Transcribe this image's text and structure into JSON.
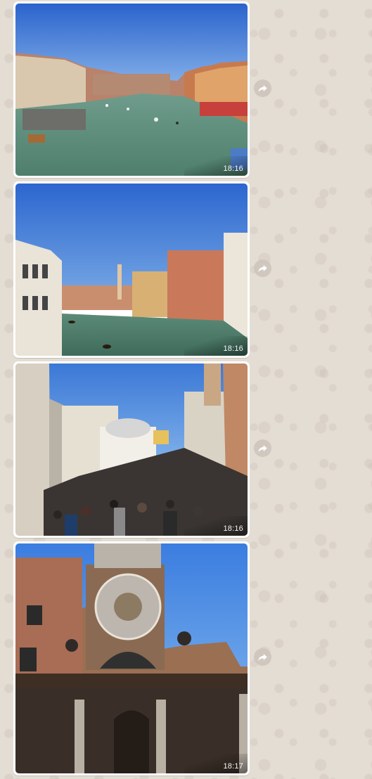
{
  "chat": {
    "messages": [
      {
        "photo": "grand-canal-view",
        "time": "18:16"
      },
      {
        "photo": "grand-canal-palazzi",
        "time": "18:16"
      },
      {
        "photo": "rialto-bridge-crowd",
        "time": "18:16"
      },
      {
        "photo": "san-giacomo-di-rialto-clock",
        "time": "18:17"
      }
    ],
    "forward_icon": "forward-arrow-icon"
  },
  "colors": {
    "wallpaper": "#e4ddd4",
    "bubble": "#ffffff",
    "sky": "#2f6fd1",
    "water": "#5d8a78"
  }
}
